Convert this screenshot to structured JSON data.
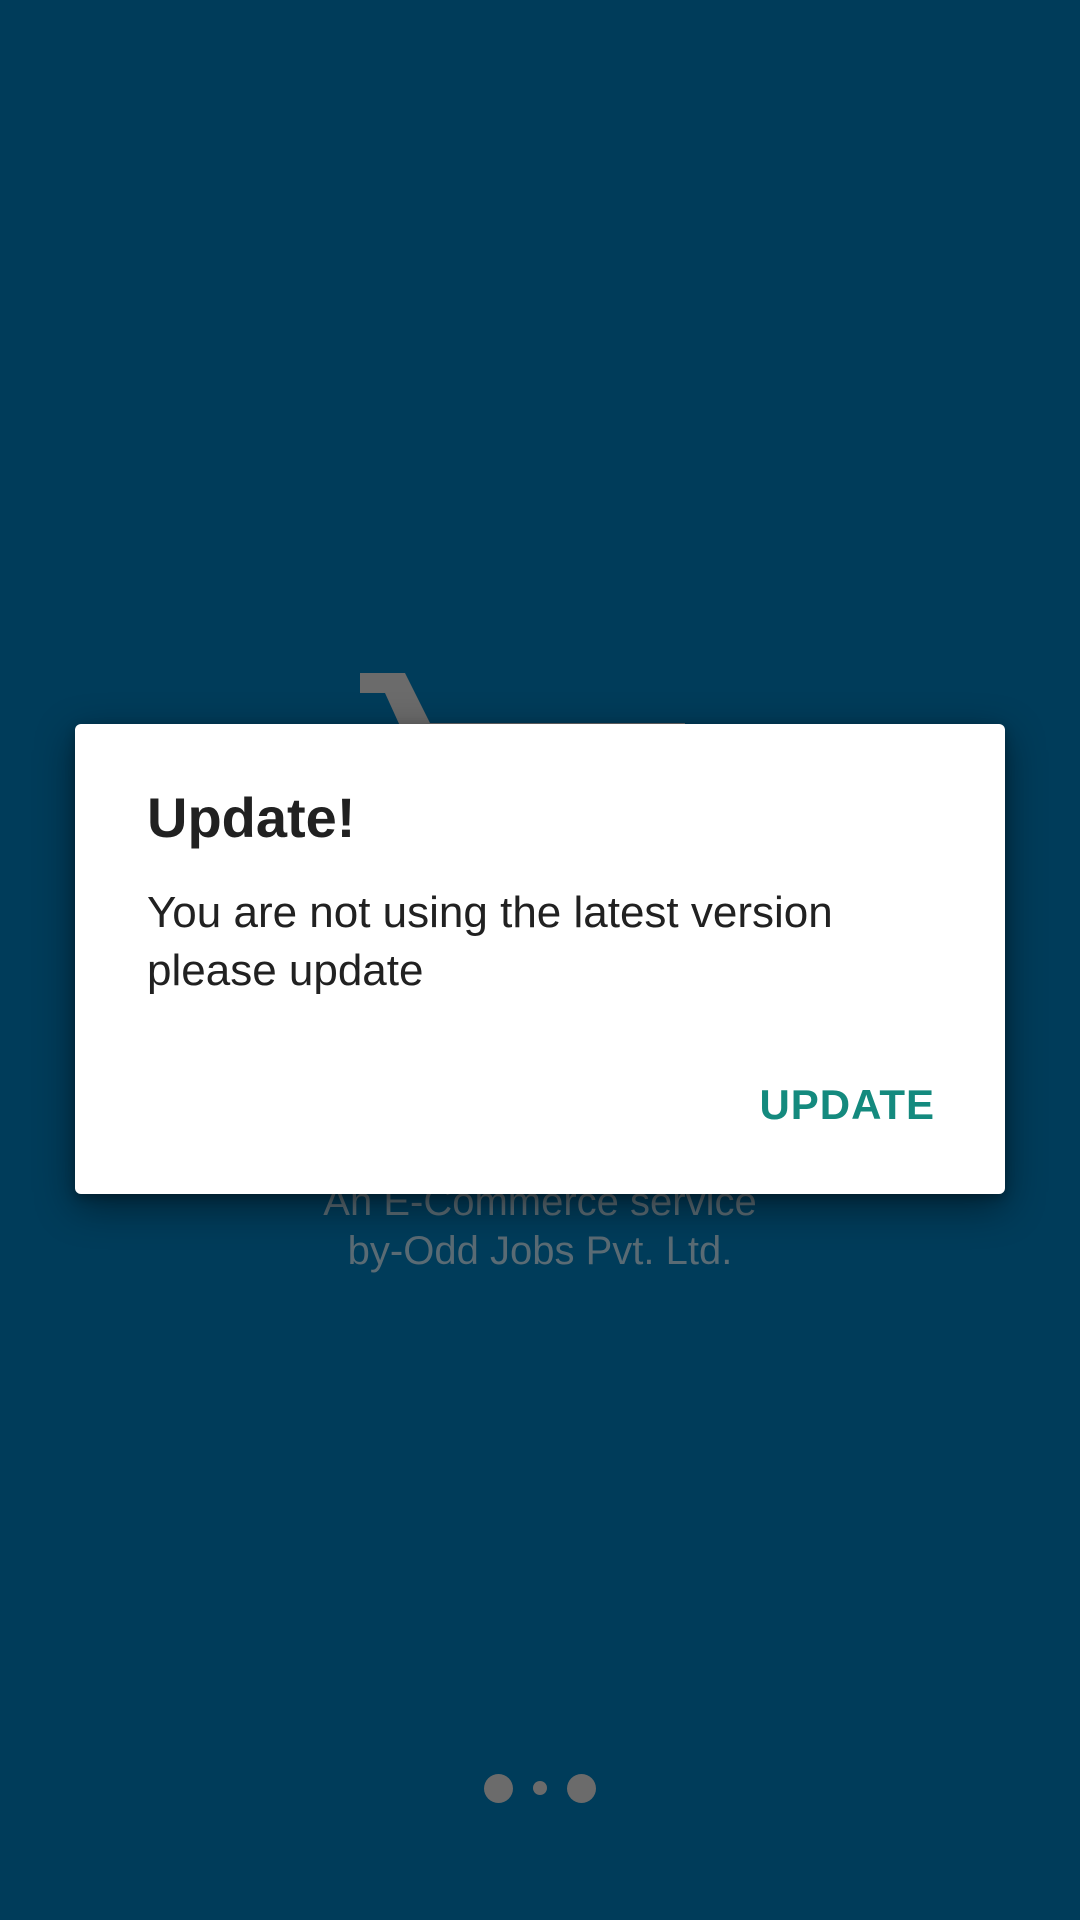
{
  "splash": {
    "tagline_line1": "An E-Commerce service",
    "tagline_line2": "by-Odd Jobs Pvt. Ltd.",
    "page_indicator": {
      "count": 3,
      "active_index": 1
    }
  },
  "dialog": {
    "title": "Update!",
    "message": "You are not using the latest version please update",
    "positive_button": "UPDATE"
  },
  "colors": {
    "background": "#003c5a",
    "dialog_background": "#ffffff",
    "accent": "#148a7e",
    "text_primary": "#212121",
    "muted": "#6b6b6b"
  }
}
